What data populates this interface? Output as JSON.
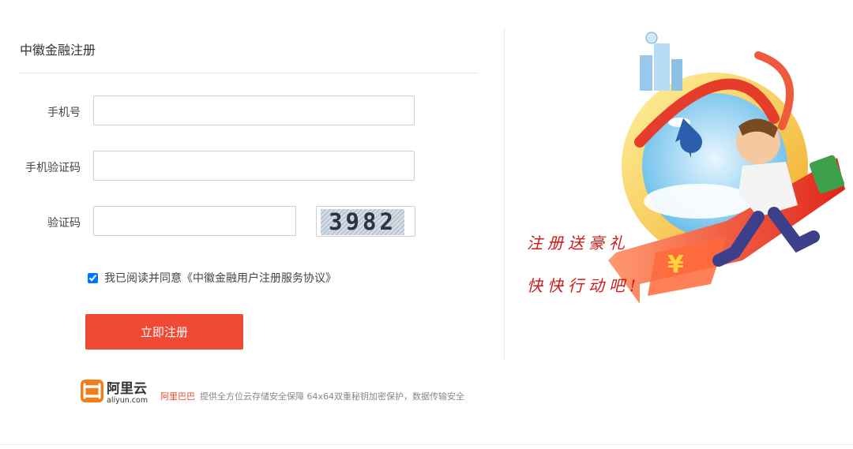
{
  "form": {
    "title": "中徽金融注册",
    "phone_label": "手机号",
    "sms_code_label": "手机验证码",
    "captcha_label": "验证码",
    "captcha_text": "3982",
    "agree_text": "我已阅读并同意《中徽金融用户注册服务协议》",
    "agree_checked": true,
    "submit_label": "立即注册"
  },
  "footer": {
    "logo_cn": "阿里云",
    "logo_en": "aliyun.com",
    "brand": "阿里巴巴",
    "note": "提供全方位云存储安全保障 64x64双重秘钥加密保护，数据传输安全"
  },
  "promo": {
    "line1": "注册送豪礼",
    "line2": "快快行动吧!"
  },
  "colors": {
    "accent": "#f04a34",
    "promo_text": "#d01818"
  }
}
